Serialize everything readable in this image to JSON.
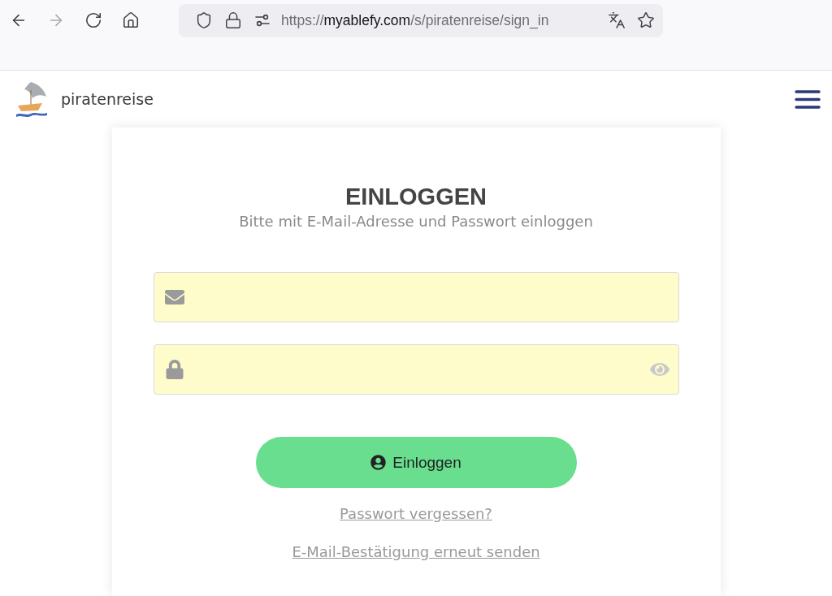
{
  "browser": {
    "nav_buttons": [
      {
        "kind": "back",
        "disabled": false
      },
      {
        "kind": "forward",
        "disabled": true
      },
      {
        "kind": "reload",
        "disabled": false
      },
      {
        "kind": "home",
        "disabled": false
      }
    ],
    "url": "https://**myablefy.com**/s/piratenreise/sign_in"
  },
  "header": {
    "site_name": "piratenreise"
  },
  "login": {
    "title": "EINLOGGEN",
    "subtitle": "Bitte mit E-Mail-Adresse und Passwort einloggen",
    "fields": [
      {
        "kind": "email"
      },
      {
        "kind": "password"
      }
    ],
    "submit": "Einloggen",
    "links": [
      "Passwort vergessen?",
      "E-Mail-Bestätigung erneut senden"
    ]
  }
}
